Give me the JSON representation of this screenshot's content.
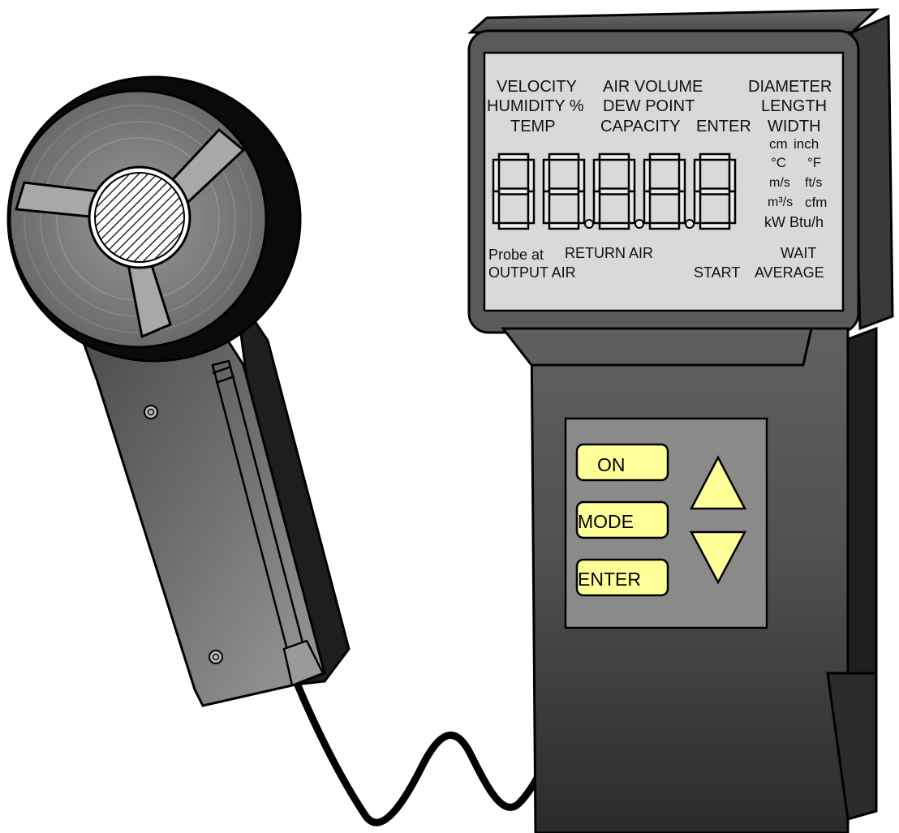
{
  "device": {
    "name_hidden": "",
    "colors": {
      "body": "#555555",
      "body_dark": "#2e2e2e",
      "lcd_bg": "#d9d9d9",
      "key_panel": "#8a8a8a",
      "key_fill": "#ffff99",
      "outline": "#000000"
    }
  },
  "lcd": {
    "labels": {
      "velocity": "VELOCITY",
      "humidity": "HUMIDITY %",
      "temp": "TEMP",
      "air_volume": "AIR VOLUME",
      "dew_point": "DEW  POINT",
      "capacity": "CAPACITY",
      "enter": "ENTER",
      "diameter": "DIAMETER",
      "length": "LENGTH",
      "width": "WIDTH",
      "probe_at": "Probe  at",
      "return_air": "RETURN  AIR",
      "output_air": "OUTPUT  AIR",
      "start": "START",
      "wait": "WAIT",
      "average": "AVERAGE"
    },
    "units": {
      "cm": "cm",
      "inch": "inch",
      "deg_c": "°C",
      "deg_f": "°F",
      "ms": "m/s",
      "fts": "ft/s",
      "m3s": "m³/s",
      "cfm": "cfm",
      "kw": "kW",
      "btuh": "Btu/h"
    },
    "digits_count": 5
  },
  "keypad": {
    "on_label": "ON",
    "mode_label": "MODE",
    "enter_label": "ENTER",
    "up_icon": "up-triangle-icon",
    "down_icon": "down-triangle-icon"
  },
  "probe": {
    "head_icon": "fan-probe-icon"
  }
}
